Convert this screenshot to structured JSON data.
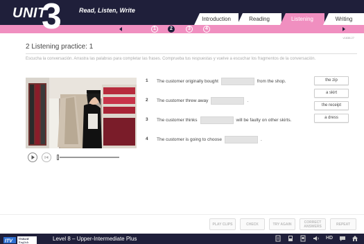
{
  "header": {
    "unit_label": "UNIT",
    "unit_number": "3",
    "subtitle": "Read, Listen, Write",
    "tabs": [
      {
        "label": "Introduction",
        "active": false
      },
      {
        "label": "Reading",
        "active": false
      },
      {
        "label": "Listening",
        "active": true
      },
      {
        "label": "Writing",
        "active": false
      }
    ]
  },
  "nav": {
    "pages": [
      "1",
      "2",
      "3",
      "4"
    ],
    "current_page": "2"
  },
  "version": "v1638.27",
  "exercise": {
    "title": "2  Listening practice: 1",
    "instructions": "Escucha la conversación. Arrastra las palabras para completar las frases. Comprueba tus respuestas y vuelve a escuchar los fragmentos de la conversación."
  },
  "sentences": [
    {
      "num": "1",
      "before": "The customer originally bought",
      "after": "from the shop."
    },
    {
      "num": "2",
      "before": "The customer threw away",
      "after": "."
    },
    {
      "num": "3",
      "before": "The customer thinks",
      "after": "will be faulty on other skirts."
    },
    {
      "num": "4",
      "before": "The customer is going to choose",
      "after": "."
    }
  ],
  "word_bank": [
    "the zip",
    "a skirt",
    "the receipt",
    "a dress"
  ],
  "actions": {
    "play_clips": "PLAY CLIPS",
    "check": "CHECK",
    "try_again": "TRY AGAIN",
    "correct_answers": "CORRECT ANSWERS",
    "repeat": "REPEAT"
  },
  "footer": {
    "logo_text": "Oxford English",
    "level": "Level 8 – Upper-Intermediate Plus",
    "hd": "HD"
  },
  "colors": {
    "header_bg": "#1f1f3a",
    "accent_pink": "#f08fc0"
  },
  "media": {
    "progress": 0.0
  }
}
